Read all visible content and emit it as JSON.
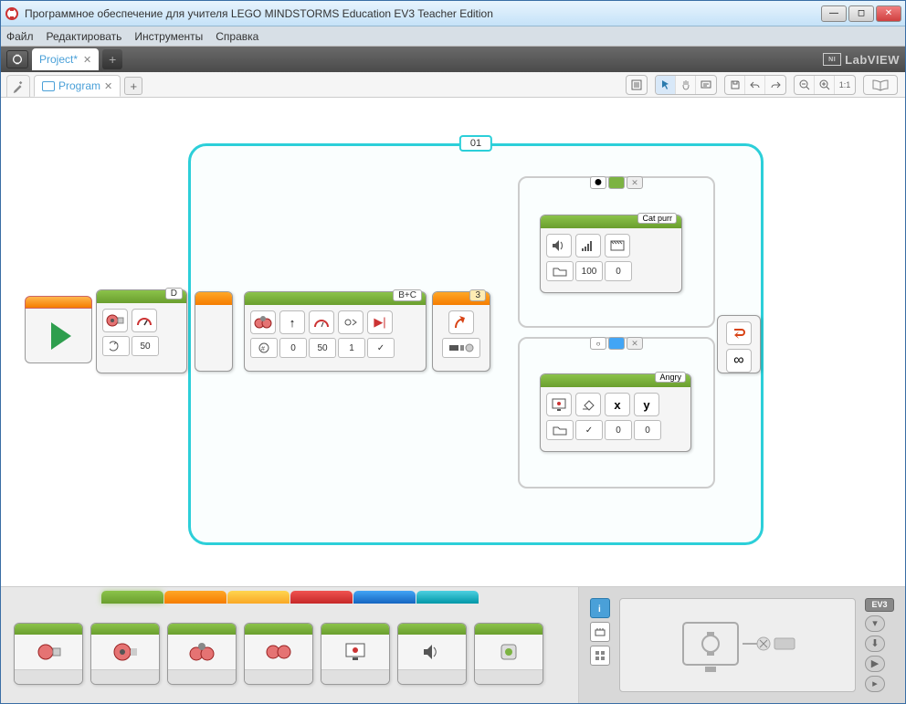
{
  "window": {
    "title": "Программное обеспечение для учителя LEGO MINDSTORMS Education EV3 Teacher Edition"
  },
  "menu": {
    "file": "Файл",
    "edit": "Редактировать",
    "tools": "Инструменты",
    "help": "Справка"
  },
  "project_tab": "Project*",
  "program_tab": "Program",
  "labview_label": "LabVIEW",
  "loop": {
    "label": "01"
  },
  "blocks": {
    "motor_d": {
      "port": "D",
      "value": "50"
    },
    "steer": {
      "port": "B+C",
      "v1": "0",
      "v2": "50",
      "v3": "1"
    },
    "sensor_port": "3",
    "sound": {
      "label": "Cat purr",
      "p1": "100",
      "p2": "0"
    },
    "display": {
      "label": "Angry",
      "p1": "✓",
      "p2": "0",
      "p3": "0"
    }
  },
  "zoom_label": "1:1",
  "hub_label": "EV3"
}
